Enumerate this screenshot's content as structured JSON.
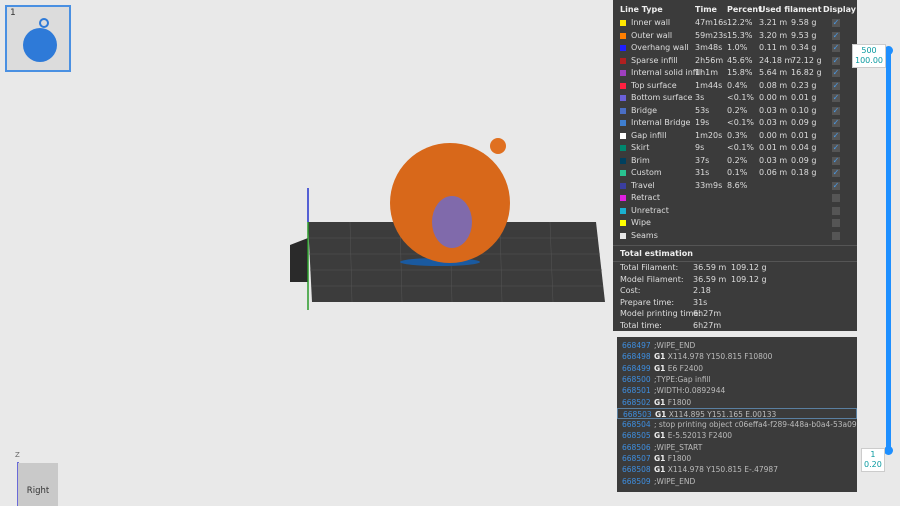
{
  "thumbnail": {
    "index": "1"
  },
  "legend": {
    "headers": [
      "Line Type",
      "Time",
      "Percent",
      "Used filament",
      "Display"
    ],
    "rows": [
      {
        "name": "Inner wall",
        "color": "#ffe600",
        "time": "47m16s",
        "percent": "12.2%",
        "length": "3.21 m",
        "weight": "9.58 g",
        "display": true
      },
      {
        "name": "Outer wall",
        "color": "#ff7f00",
        "time": "59m23s",
        "percent": "15.3%",
        "length": "3.20 m",
        "weight": "9.53 g",
        "display": true
      },
      {
        "name": "Overhang wall",
        "color": "#1f1fff",
        "time": "3m48s",
        "percent": "1.0%",
        "length": "0.11 m",
        "weight": "0.34 g",
        "display": true
      },
      {
        "name": "Sparse infill",
        "color": "#b02020",
        "time": "2h56m",
        "percent": "45.6%",
        "length": "24.18 m",
        "weight": "72.12 g",
        "display": true
      },
      {
        "name": "Internal solid infill",
        "color": "#9f3fbf",
        "time": "1h1m",
        "percent": "15.8%",
        "length": "5.64 m",
        "weight": "16.82 g",
        "display": true
      },
      {
        "name": "Top surface",
        "color": "#ff2040",
        "time": "1m44s",
        "percent": "0.4%",
        "length": "0.08 m",
        "weight": "0.23 g",
        "display": true
      },
      {
        "name": "Bottom surface",
        "color": "#6a60d8",
        "time": "3s",
        "percent": "<0.1%",
        "length": "0.00 m",
        "weight": "0.01 g",
        "display": true
      },
      {
        "name": "Bridge",
        "color": "#4a6ec4",
        "time": "53s",
        "percent": "0.2%",
        "length": "0.03 m",
        "weight": "0.10 g",
        "display": true
      },
      {
        "name": "Internal Bridge",
        "color": "#3f7fd0",
        "time": "19s",
        "percent": "<0.1%",
        "length": "0.03 m",
        "weight": "0.09 g",
        "display": true
      },
      {
        "name": "Gap infill",
        "color": "#ffffff",
        "time": "1m20s",
        "percent": "0.3%",
        "length": "0.00 m",
        "weight": "0.01 g",
        "display": true
      },
      {
        "name": "Skirt",
        "color": "#00876e",
        "time": "9s",
        "percent": "<0.1%",
        "length": "0.01 m",
        "weight": "0.04 g",
        "display": true
      },
      {
        "name": "Brim",
        "color": "#00405f",
        "time": "37s",
        "percent": "0.2%",
        "length": "0.03 m",
        "weight": "0.09 g",
        "display": true
      },
      {
        "name": "Custom",
        "color": "#29c290",
        "time": "31s",
        "percent": "0.1%",
        "length": "0.06 m",
        "weight": "0.18 g",
        "display": true
      },
      {
        "name": "Travel",
        "color": "#3a3ea0",
        "time": "33m9s",
        "percent": "8.6%",
        "length": "",
        "weight": "",
        "display": true
      },
      {
        "name": "Retract",
        "color": "#e020e0",
        "time": "",
        "percent": "",
        "length": "",
        "weight": "",
        "display": false
      },
      {
        "name": "Unretract",
        "color": "#1ab0d0",
        "time": "",
        "percent": "",
        "length": "",
        "weight": "",
        "display": false
      },
      {
        "name": "Wipe",
        "color": "#ffff00",
        "time": "",
        "percent": "",
        "length": "",
        "weight": "",
        "display": false
      },
      {
        "name": "Seams",
        "color": "#e8e8e8",
        "time": "",
        "percent": "",
        "length": "",
        "weight": "",
        "display": false
      }
    ]
  },
  "estimation": {
    "title": "Total estimation",
    "rows": [
      {
        "label": "Total Filament:",
        "v1": "36.59 m",
        "v2": "109.12 g"
      },
      {
        "label": "Model Filament:",
        "v1": "36.59 m",
        "v2": "109.12 g"
      },
      {
        "label": "Cost:",
        "v1": "2.18",
        "v2": ""
      },
      {
        "label": "Prepare time:",
        "v1": "31s",
        "v2": ""
      },
      {
        "label": "Model printing time:",
        "v1": "6h27m",
        "v2": ""
      },
      {
        "label": "Total time:",
        "v1": "6h27m",
        "v2": ""
      }
    ]
  },
  "gcode": [
    {
      "n": "668497",
      "cmd": "",
      "args": ";WIPE_END"
    },
    {
      "n": "668498",
      "cmd": "G1",
      "args": "X114.978 Y150.815 F10800"
    },
    {
      "n": "668499",
      "cmd": "G1",
      "args": "E6 F2400"
    },
    {
      "n": "668500",
      "cmd": "",
      "args": ";TYPE:Gap infill"
    },
    {
      "n": "668501",
      "cmd": "",
      "args": ";WIDTH:0.0892944"
    },
    {
      "n": "668502",
      "cmd": "G1",
      "args": "F1800"
    },
    {
      "n": "668503",
      "cmd": "G1",
      "args": "X114.895 Y151.165 E.00133",
      "selected": true
    },
    {
      "n": "668504",
      "cmd": "",
      "args": "; stop printing object c06effa4-f289-448a-b0a4-53a09..."
    },
    {
      "n": "668505",
      "cmd": "G1",
      "args": "E-5.52013 F2400"
    },
    {
      "n": "668506",
      "cmd": "",
      "args": ";WIPE_START"
    },
    {
      "n": "668507",
      "cmd": "G1",
      "args": "F1800"
    },
    {
      "n": "668508",
      "cmd": "G1",
      "args": "X114.978 Y150.815 E-.47987"
    },
    {
      "n": "668509",
      "cmd": "",
      "args": ";WIPE_END"
    }
  ],
  "layer_slider": {
    "top_layer": "500",
    "top_height": "100.00",
    "bottom_layer": "1",
    "bottom_height": "0.20"
  },
  "view_cube": {
    "face": "Right",
    "axis": "Z"
  }
}
